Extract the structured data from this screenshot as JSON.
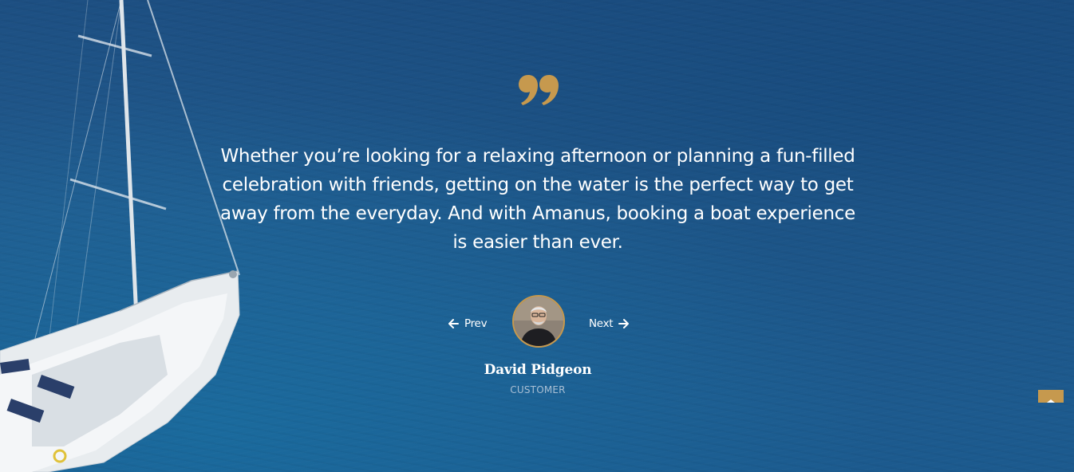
{
  "testimonial": {
    "quote_text": "Whether you’re looking for a relaxing afternoon or planning a fun-filled celebration with friends, getting on the water is the perfect way to get away from the everyday. And with Amanus, booking a boat experience is easier than ever.",
    "author_name": "David Pidgeon",
    "author_role": "CUSTOMER"
  },
  "navigation": {
    "prev_label": "Prev",
    "next_label": "Next"
  },
  "icons": {
    "quote": "quote-icon",
    "prev": "arrow-left-icon",
    "next": "arrow-right-icon",
    "back_to_top": "chevron-up-icon"
  },
  "colors": {
    "accent": "#c6994e",
    "background": "#1f5586",
    "text": "#ffffff",
    "role_text": "#a9bfd4"
  }
}
